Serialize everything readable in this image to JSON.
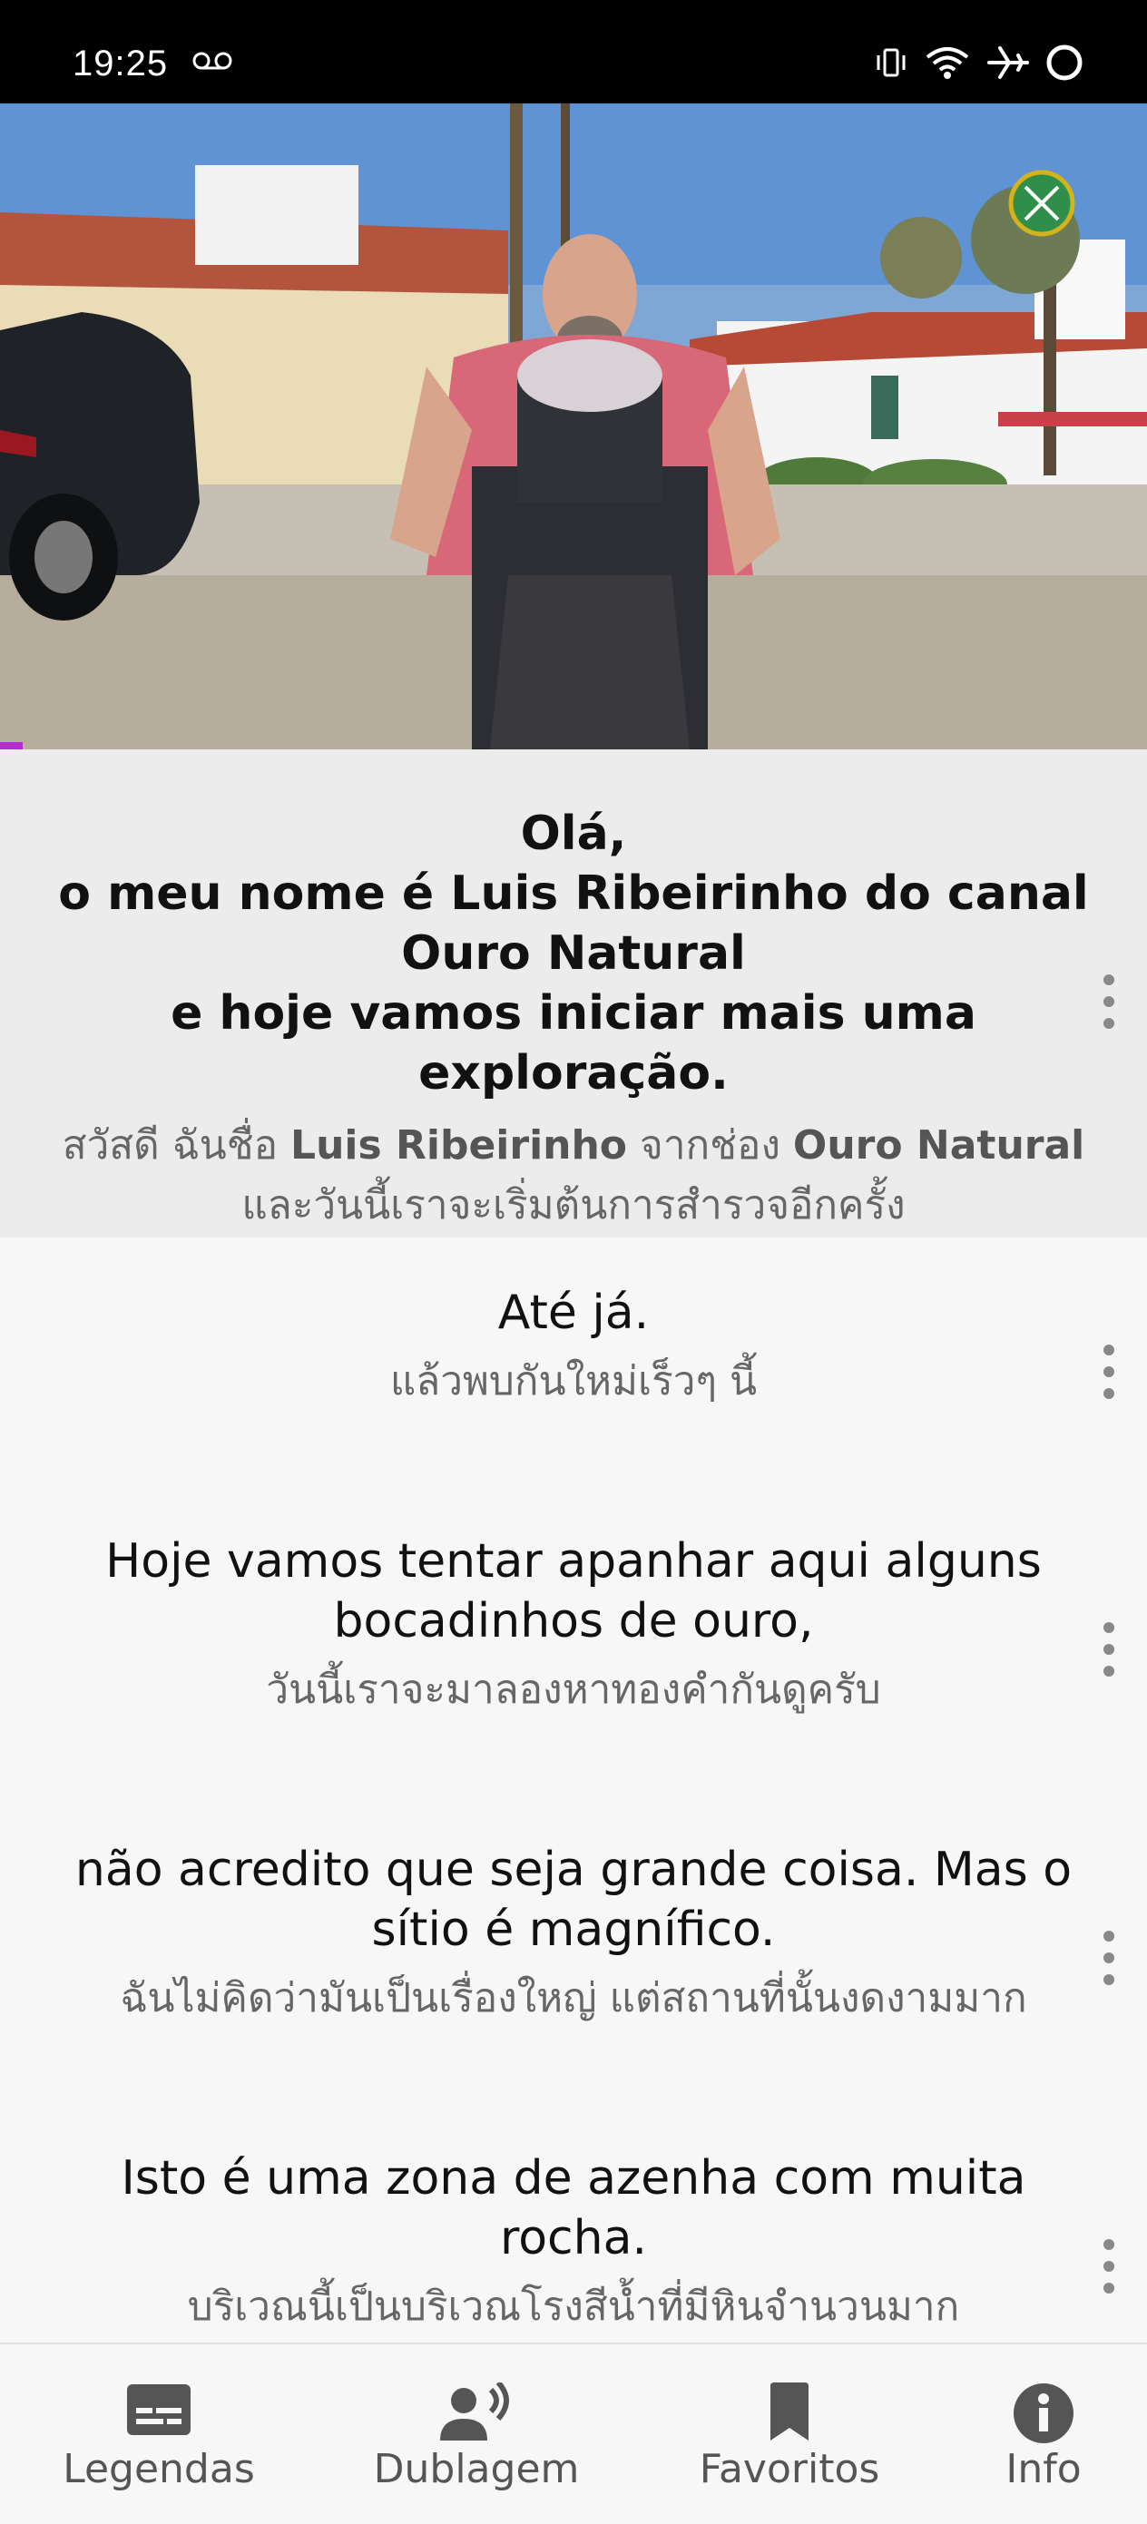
{
  "status_bar": {
    "time": "19:25",
    "icons": [
      "voicemail-icon",
      "vibrate-icon",
      "wifi-icon",
      "airplane-icon",
      "circle-icon"
    ]
  },
  "video": {
    "logo_icon": "channel-logo-icon",
    "progress_fraction": 0.02,
    "progress_color": "#b52bd2"
  },
  "transcript": [
    {
      "active": true,
      "original": [
        "Olá,",
        "o meu nome é Luis Ribeirinho do canal",
        "Ouro Natural",
        "e hoje vamos iniciar mais uma exploração."
      ],
      "translation_line1_a": "สวัสดี ฉันชื่อ ",
      "translation_line1_b": "Luis Ribeirinho",
      "translation_line1_c": " จากช่อง ",
      "translation_line1_d": "Ouro Natural",
      "translation_line2": "และวันนี้เราจะเริ่มต้นการสำรวจอีกครั้ง"
    },
    {
      "original": [
        "Até já."
      ],
      "translation": "แล้วพบกันใหม่เร็วๆ นี้"
    },
    {
      "original": [
        "Hoje vamos tentar apanhar aqui alguns",
        "bocadinhos de ouro,"
      ],
      "translation": "วันนี้เราจะมาลองหาทองคำกันดูครับ"
    },
    {
      "original": [
        "não acredito que seja grande coisa. Mas o",
        "sítio é magnífico."
      ],
      "translation": "ฉันไม่คิดว่ามันเป็นเรื่องใหญ่ แต่สถานที่นั้นงดงามมาก"
    },
    {
      "original": [
        "Isto é uma zona de azenha com muita",
        "rocha."
      ],
      "translation": "บริเวณนี้เป็นบริเวณโรงสีน้ำที่มีหินจำนวนมาก"
    }
  ],
  "bottom_nav": [
    {
      "label": "Legendas",
      "icon": "subtitles-icon"
    },
    {
      "label": "Dublagem",
      "icon": "voice-over-icon"
    },
    {
      "label": "Favoritos",
      "icon": "bookmark-icon"
    },
    {
      "label": "Info",
      "icon": "info-icon"
    }
  ],
  "colors": {
    "status_bar_bg": "#000000",
    "active_cue_bg": "#ececec",
    "list_bg": "#f7f7f7",
    "accent": "#b52bd2"
  }
}
